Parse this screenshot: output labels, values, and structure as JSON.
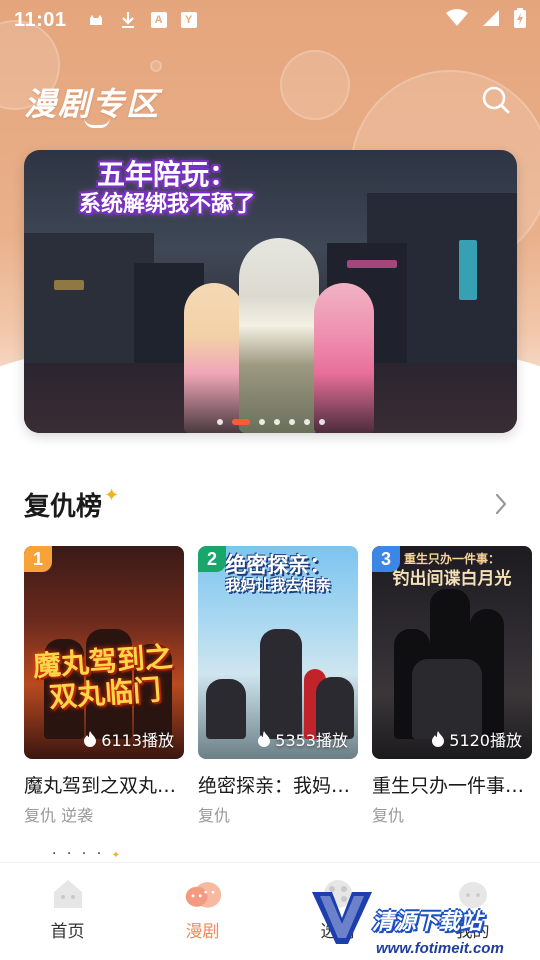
{
  "status_bar": {
    "time": "11:01",
    "left_icons": [
      "cat-icon",
      "download-icon",
      "a-icon",
      "y-icon"
    ],
    "a_glyph": "A",
    "y_glyph": "Y",
    "right_icons": [
      "wifi-icon",
      "signal-icon",
      "battery-charging-icon"
    ]
  },
  "header": {
    "title": "漫剧专区",
    "search_icon": "search-icon",
    "bg_color": "#e9aa80"
  },
  "banner": {
    "title_line1": "五年陪玩：",
    "title_line2": "系统解绑我不舔了",
    "dot_count": 7,
    "active_dot_index": 1,
    "active_dot_color": "#ff5a36"
  },
  "section": {
    "title": "复仇榜",
    "more_icon": "chevron-right-icon",
    "items": [
      {
        "rank": "1",
        "cover_text_line1": "魔丸驾到之",
        "cover_text_line2": "双丸临门",
        "plays": "6113播放",
        "title": "魔丸驾到之双丸临门",
        "tags": "复仇 逆袭",
        "rank_color": "#f7a33a"
      },
      {
        "rank": "2",
        "cover_text_line1": "绝密探亲：",
        "cover_text_line2": "我妈让我去相亲",
        "plays": "5353播放",
        "title": "绝密探亲：我妈让我去相亲",
        "tags": "复仇",
        "rank_color": "#1aa66a"
      },
      {
        "rank": "3",
        "cover_text_line1": "重生只办一件事：",
        "cover_text_line2": "钓出间谍白月光",
        "plays": "5120播放",
        "title": "重生只办一件事：钓出间谍白月光",
        "tags": "复仇",
        "rank_color": "#3d86e6"
      }
    ]
  },
  "bottom_nav": [
    {
      "label": "首页",
      "icon": "home-icon",
      "active": false
    },
    {
      "label": "漫剧",
      "icon": "anime-face-icon",
      "active": true
    },
    {
      "label": "选剧",
      "icon": "film-reel-icon",
      "active": false
    },
    {
      "label": "我的",
      "icon": "profile-face-icon",
      "active": false
    }
  ],
  "accent_color": "#f08b5b",
  "watermark": {
    "text": "清源下载站",
    "url": "www.fotimeit.com"
  }
}
